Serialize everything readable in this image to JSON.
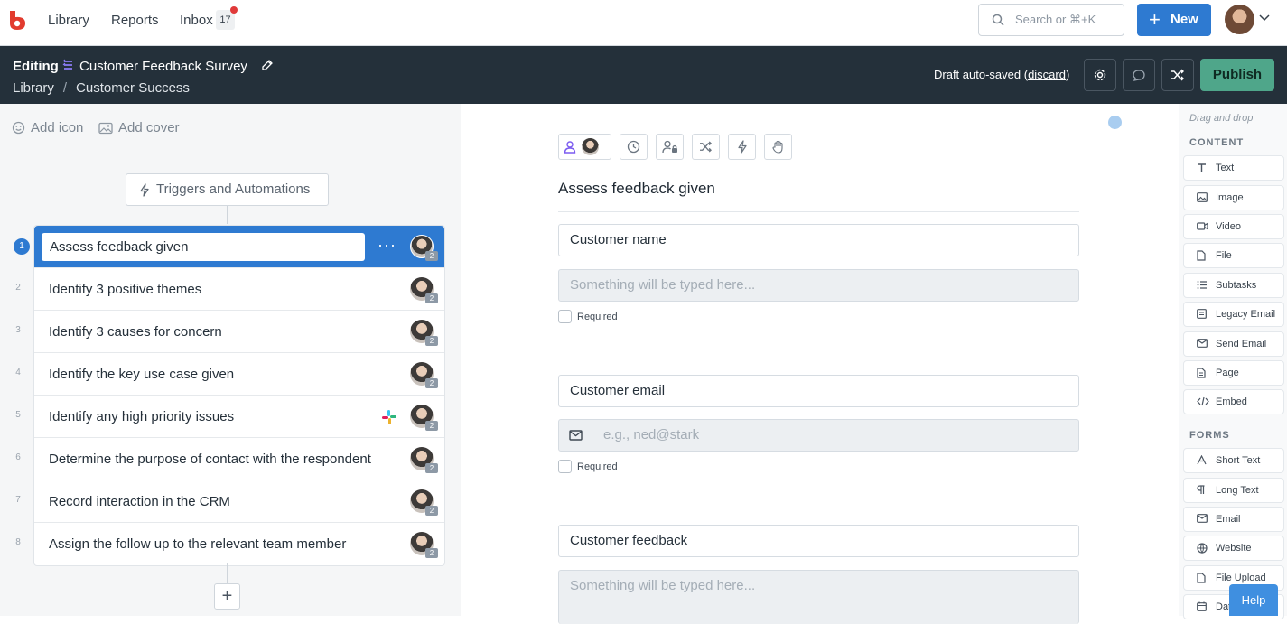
{
  "topnav": {
    "links": [
      "Library",
      "Reports",
      "Inbox"
    ],
    "inbox_count": "17",
    "search_placeholder": "Search or ⌘+K",
    "new_label": "New"
  },
  "header": {
    "mode": "Editing",
    "title": "Customer Feedback Survey",
    "breadcrumb": [
      "Library",
      "Customer Success"
    ],
    "draft_text": "Draft auto-saved",
    "discard_label": "discard",
    "publish_label": "Publish"
  },
  "left": {
    "add_icon": "Add icon",
    "add_cover": "Add cover",
    "triggers_label": "Triggers and Automations",
    "tasks": [
      {
        "num": "1",
        "name": "Assess feedback given",
        "badge": "2"
      },
      {
        "num": "2",
        "name": "Identify 3 positive themes",
        "badge": "2"
      },
      {
        "num": "3",
        "name": "Identify 3 causes for concern",
        "badge": "2"
      },
      {
        "num": "4",
        "name": "Identify the key use case given",
        "badge": "2"
      },
      {
        "num": "5",
        "name": "Identify any high priority issues",
        "badge": "2"
      },
      {
        "num": "6",
        "name": "Determine the purpose of contact with the respondent",
        "badge": "2"
      },
      {
        "num": "7",
        "name": "Record interaction in the CRM",
        "badge": "2"
      },
      {
        "num": "8",
        "name": "Assign the follow up to the relevant team member",
        "badge": "2"
      }
    ]
  },
  "main": {
    "step_title": "Assess feedback given",
    "fields": [
      {
        "label": "Customer name",
        "placeholder": "Something will be typed here...",
        "required": "Required"
      },
      {
        "label": "Customer email",
        "placeholder": "e.g., ned@stark",
        "required": "Required"
      },
      {
        "label": "Customer feedback",
        "placeholder": "Something will be typed here..."
      }
    ]
  },
  "panel": {
    "drag_hint": "Drag and drop",
    "content_heading": "CONTENT",
    "content_items": [
      "Text",
      "Image",
      "Video",
      "File",
      "Subtasks",
      "Legacy Email",
      "Send Email",
      "Page",
      "Embed"
    ],
    "forms_heading": "FORMS",
    "form_items": [
      "Short Text",
      "Long Text",
      "Email",
      "Website",
      "File Upload",
      "Date"
    ]
  },
  "help_label": "Help",
  "colors": {
    "accent": "#2e7ad1",
    "header_bg": "#24303a",
    "publish": "#4fa68a"
  }
}
